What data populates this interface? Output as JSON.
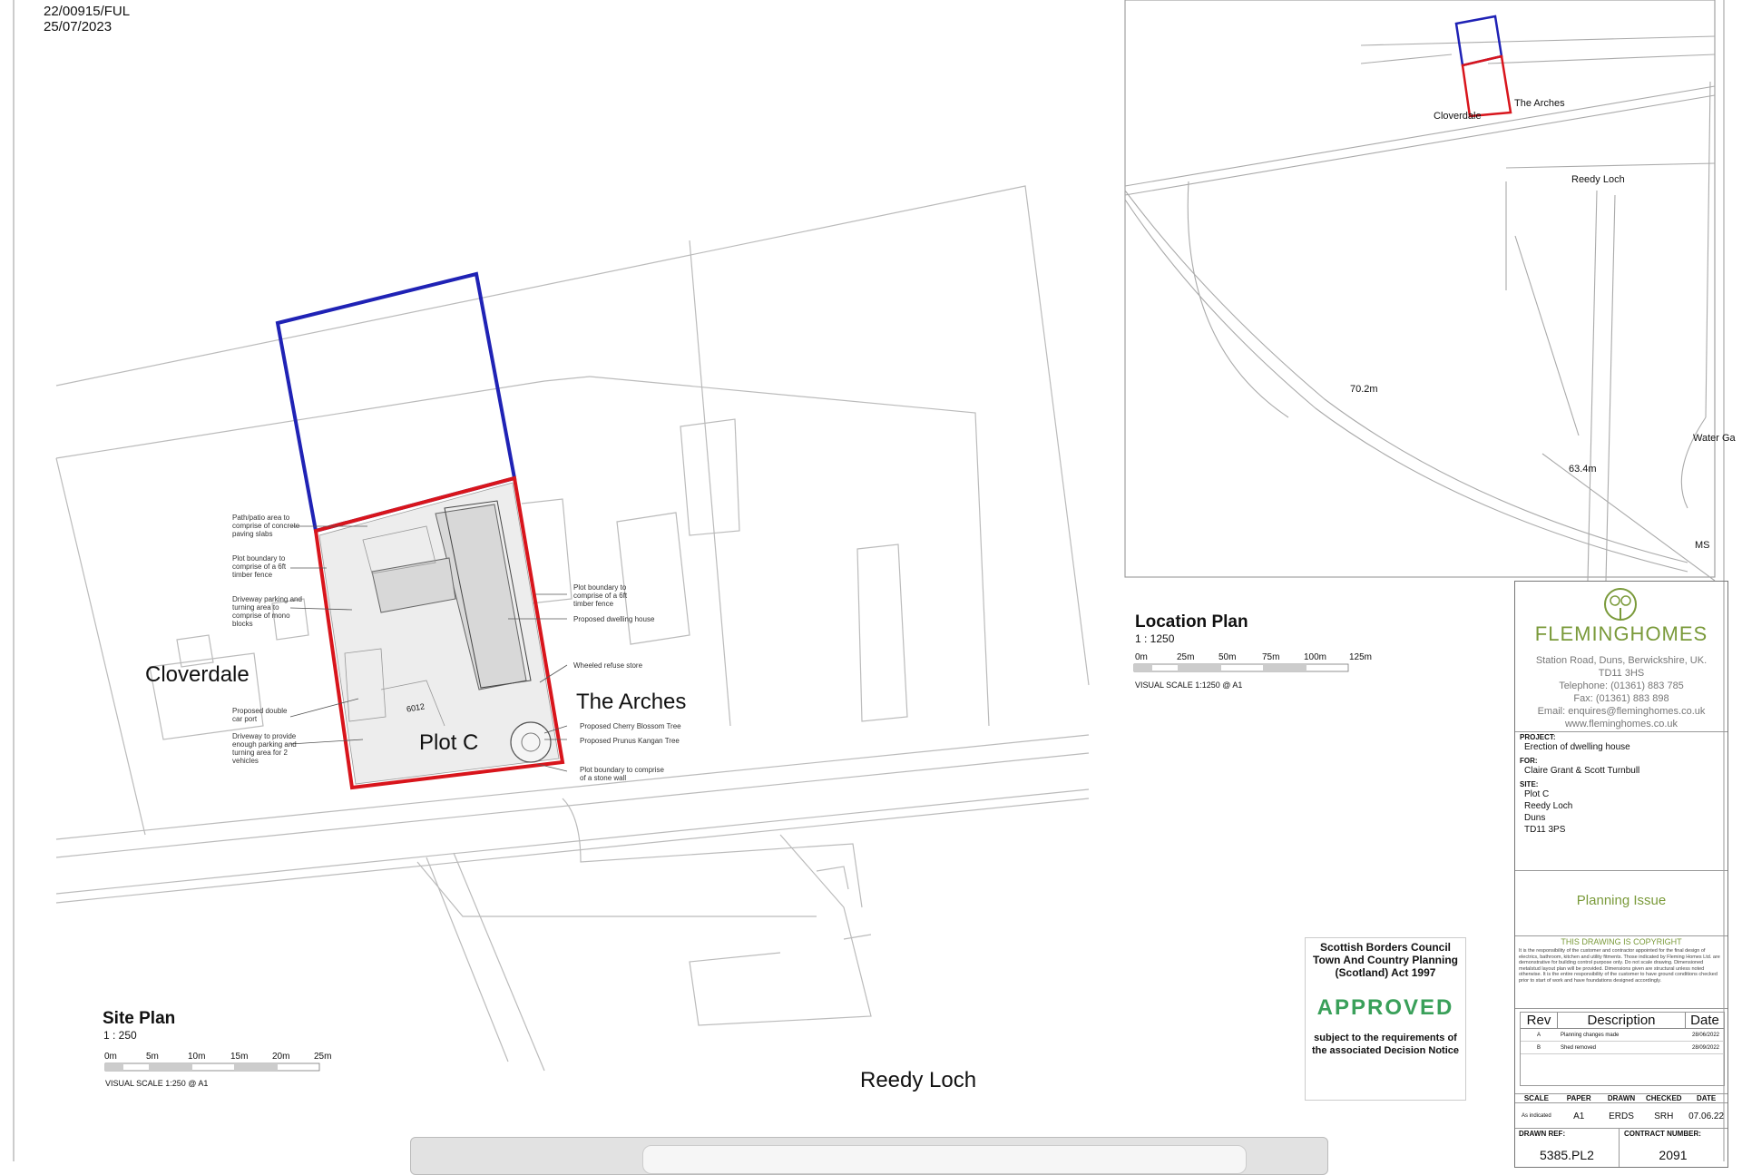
{
  "header": {
    "ref_number": "22/00915/FUL",
    "ref_date": "25/07/2023"
  },
  "site_plan": {
    "labels": {
      "cloverdale": "Cloverdale",
      "the_arches": "The Arches",
      "plot_c": "Plot C",
      "reedy_loch": "Reedy Loch"
    },
    "dimension": "6012",
    "annotations_left": [
      "Path/patio area to comprise of concrete paving slabs",
      "Plot boundary to comprise of a 6ft timber fence",
      "Driveway parking and turning area to comprise of mono blocks",
      "Proposed double car port",
      "Driveway to provide enough parking and turning area for 2 vehicles"
    ],
    "annotations_right": [
      "Plot boundary to comprise of a 6ft timber fence",
      "Proposed dwelling house",
      "Wheeled refuse store",
      "Proposed Cherry Blossom Tree",
      "Proposed Prunus Kangan Tree",
      "Plot boundary to comprise of a stone wall"
    ],
    "title": "Site Plan",
    "scale": "1 : 250",
    "scale_ticks": [
      "0m",
      "5m",
      "10m",
      "15m",
      "20m",
      "25m"
    ],
    "visual_scale": "VISUAL SCALE 1:250  @ A1"
  },
  "location_plan": {
    "labels": {
      "cloverdale": "Cloverdale",
      "the_arches": "The Arches",
      "reedy_loch": "Reedy Loch",
      "level_1": "70.2m",
      "level_2": "63.4m",
      "water_ga": "Water Ga",
      "ms": "MS"
    },
    "title": "Location Plan",
    "scale": "1 : 1250",
    "scale_ticks": [
      "0m",
      "25m",
      "50m",
      "75m",
      "100m",
      "125m"
    ],
    "visual_scale": "VISUAL SCALE 1:1250  @ A1"
  },
  "approval": {
    "authority": "Scottish Borders Council Town And Country Planning (Scotland) Act 1997",
    "status": "APPROVED",
    "condition": "subject to the requirements of the associated Decision Notice",
    "status_color": "#3aa05a"
  },
  "title_block": {
    "company": "FLEMINGHOMES",
    "brand_color": "#7a9a3a",
    "address": "Station Road, Duns, Berwickshire, UK.",
    "postcode": "TD11 3HS",
    "telephone": "Telephone: (01361) 883 785",
    "fax": "Fax: (01361) 883 898",
    "email": "Email: enquires@fleminghomes.co.uk",
    "website": "www.fleminghomes.co.uk",
    "project_label": "PROJECT:",
    "project": "Erection of dwelling house",
    "for_label": "FOR:",
    "for": "Claire Grant & Scott Turnbull",
    "site_label": "SITE:",
    "site_lines": [
      "Plot C",
      "Reedy Loch",
      "Duns",
      "TD11 3PS"
    ],
    "issue": "Planning Issue",
    "copyright_title": "THIS DRAWING IS COPYRIGHT",
    "copyright_text": "It is the responsibility of the customer and contractor appointed for the final design of electrics, bathroom, kitchen and utility fitments. Those indicated by Fleming Homes Ltd. are demonstrative for building control purpose only. Do not scale drawing. Dimensioned metalstud layout plan will be provided. Dimensions given are structural unless noted otherwise. It is the entire responsibility of the customer to have ground conditions checked prior to start of work and have foundations designed accordingly.",
    "rev_headers": [
      "Rev",
      "Description",
      "Date"
    ],
    "revisions": [
      {
        "rev": "A",
        "desc": "Planning changes made",
        "date": "28/06/2022"
      },
      {
        "rev": "B",
        "desc": "Shed removed",
        "date": "28/09/2022"
      }
    ],
    "info_headers": [
      "SCALE",
      "PAPER",
      "DRAWN",
      "CHECKED",
      "DATE"
    ],
    "info_values": [
      "As indicated",
      "A1",
      "ERDS",
      "SRH",
      "07.06.22"
    ],
    "drawn_ref_label": "DRAWN REF:",
    "drawn_ref": "5385.PL2",
    "contract_label": "CONTRACT NUMBER:",
    "contract": "2091"
  }
}
